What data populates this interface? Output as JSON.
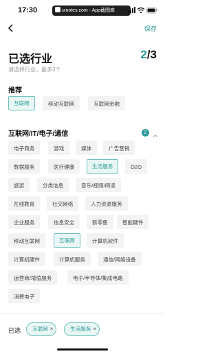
{
  "status_bar": {
    "time": "17:30",
    "watermark": "uinotes.com - App截图库",
    "icons": [
      "signal-icon",
      "wifi-icon",
      "battery-icon"
    ]
  },
  "nav": {
    "back_icon": "chevron-left-icon",
    "save_label": "保存"
  },
  "header": {
    "title": "已选行业",
    "count_current": "2",
    "count_total": "/3",
    "subtitle": "请选择行业，最多3个"
  },
  "recommended": {
    "title": "推荐",
    "tags": [
      {
        "label": "互联网",
        "selected": true
      },
      {
        "label": "移动互联网",
        "selected": false
      },
      {
        "label": "互联网金融",
        "selected": false
      }
    ]
  },
  "category": {
    "title": "互联网/IT/电子/通信",
    "selected_count": "2",
    "collapse_icon": "chevron-up-icon",
    "tags": [
      {
        "label": "电子商务",
        "selected": false
      },
      {
        "label": "游戏",
        "selected": false
      },
      {
        "label": "媒体",
        "selected": false
      },
      {
        "label": "广告营销",
        "selected": false
      },
      {
        "label": "数据服务",
        "selected": false
      },
      {
        "label": "医疗健康",
        "selected": false
      },
      {
        "label": "生活服务",
        "selected": true
      },
      {
        "label": "O2O",
        "selected": false
      },
      {
        "label": "旅游",
        "selected": false
      },
      {
        "label": "分类信息",
        "selected": false
      },
      {
        "label": "音乐/视频/阅读",
        "selected": false
      },
      {
        "label": "在线教育",
        "selected": false
      },
      {
        "label": "社交网络",
        "selected": false
      },
      {
        "label": "人力资源服务",
        "selected": false
      },
      {
        "label": "企业服务",
        "selected": false
      },
      {
        "label": "信息安全",
        "selected": false
      },
      {
        "label": "新零售",
        "selected": false
      },
      {
        "label": "智能硬件",
        "selected": false
      },
      {
        "label": "移动互联网",
        "selected": false
      },
      {
        "label": "互联网",
        "selected": true
      },
      {
        "label": "计算机软件",
        "selected": false
      },
      {
        "label": "计算机硬件",
        "selected": false
      },
      {
        "label": "计算机服务",
        "selected": false
      },
      {
        "label": "通信/网络设备",
        "selected": false
      },
      {
        "label": "运营商/增值服务",
        "selected": false
      },
      {
        "label": "电子/半导体/集成电路",
        "selected": false
      },
      {
        "label": "消费电子",
        "selected": false
      }
    ]
  },
  "selected_bar": {
    "label": "已选",
    "chips": [
      {
        "label": "互联网",
        "remove": "×"
      },
      {
        "label": "生活服务",
        "remove": "×"
      }
    ]
  },
  "colors": {
    "accent": "#2a9a9a",
    "selected_bg": "#e8f6f4",
    "tag_bg": "#f3f3f3"
  }
}
